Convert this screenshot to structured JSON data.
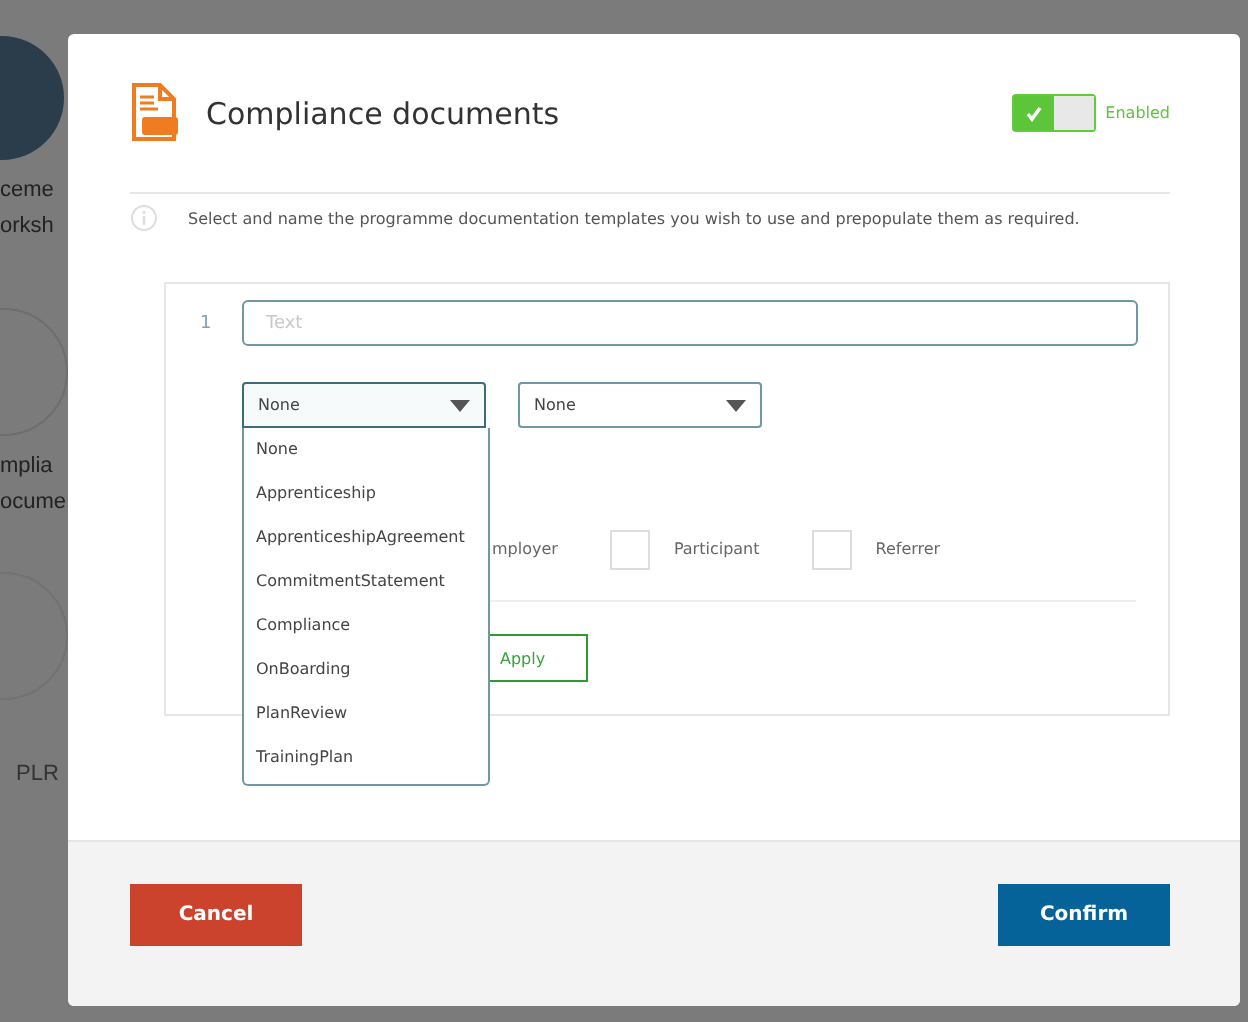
{
  "background": {
    "cards": [
      {
        "kind": "filled",
        "lines": [
          "ceme",
          "orksh"
        ]
      },
      {
        "kind": "outline",
        "lines": [
          "mplia",
          "ocume"
        ]
      },
      {
        "kind": "faint",
        "lines": [
          "PLR"
        ]
      }
    ]
  },
  "dialog": {
    "title": "Compliance documents",
    "toggle": {
      "on": true,
      "label": "Enabled"
    },
    "info": "Select and name the programme documentation templates you wish to use and prepopulate them as required.",
    "template": {
      "number": "1",
      "name_field": {
        "placeholder": "Text"
      },
      "selects": [
        {
          "value": "None",
          "expanded": true
        },
        {
          "value": "None",
          "expanded": false
        }
      ],
      "options": [
        "None",
        "Apprenticeship",
        "ApprenticeshipAgreement",
        "CommitmentStatement",
        "Compliance",
        "OnBoarding",
        "PlanReview",
        "TrainingPlan"
      ],
      "partial_label": "mployer",
      "checkboxes": [
        {
          "label": "Participant",
          "checked": false
        },
        {
          "label": "Referrer",
          "checked": false
        }
      ],
      "apply_button": "Apply"
    },
    "buttons": {
      "cancel": "Cancel",
      "confirm": "Confirm"
    }
  }
}
